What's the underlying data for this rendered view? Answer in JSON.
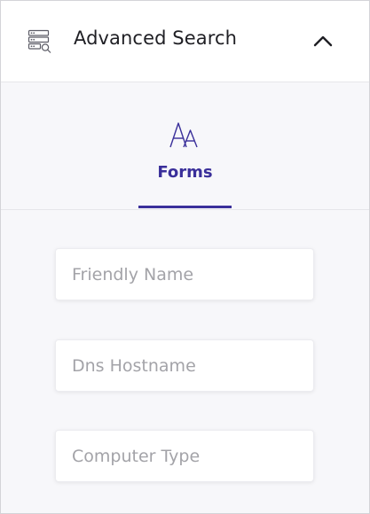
{
  "header": {
    "title": "Advanced Search",
    "icon": "search-list-icon",
    "collapse_icon": "chevron-up-icon"
  },
  "tabs": [
    {
      "label": "Forms",
      "icon": "font-size-icon",
      "active": true
    }
  ],
  "fields": [
    {
      "placeholder": "Friendly Name",
      "value": ""
    },
    {
      "placeholder": "Dns Hostname",
      "value": ""
    },
    {
      "placeholder": "Computer Type",
      "value": ""
    }
  ],
  "colors": {
    "accent": "#3a2f9a",
    "placeholder": "#a3a3a8",
    "background": "#f7f7fa"
  }
}
